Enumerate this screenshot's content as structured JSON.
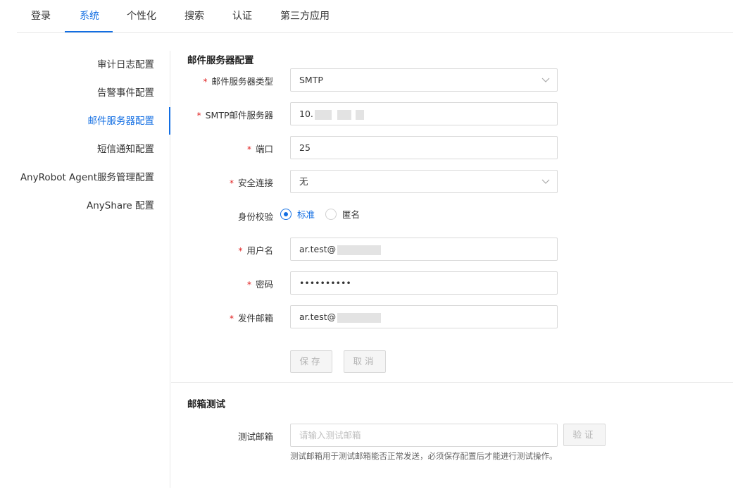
{
  "top_tabs": [
    "登录",
    "系统",
    "个性化",
    "搜索",
    "认证",
    "第三方应用"
  ],
  "side_nav": [
    "审计日志配置",
    "告警事件配置",
    "邮件服务器配置",
    "短信通知配置",
    "AnyRobot Agent服务管理配置",
    "AnyShare 配置"
  ],
  "mail_server": {
    "title": "邮件服务器配置",
    "required_mark": "*",
    "type_label": "邮件服务器类型",
    "type_value": "SMTP",
    "smtp_label": "SMTP邮件服务器",
    "smtp_value": "10.",
    "port_label": "端口",
    "port_value": "25",
    "security_label": "安全连接",
    "security_value": "无",
    "auth_label": "身份校验",
    "auth_options": [
      "标准",
      "匿名"
    ],
    "auth_selected": "标准",
    "username_label": "用户名",
    "username_value": "ar.test@",
    "password_label": "密码",
    "password_value": "••••••••••",
    "sender_label": "发件邮箱",
    "sender_value": "ar.test@",
    "save_label": "保存",
    "cancel_label": "取消"
  },
  "mail_test": {
    "title": "邮箱测试",
    "test_label": "测试邮箱",
    "test_placeholder": "请输入测试邮箱",
    "verify_label": "验证",
    "hint": "测试邮箱用于测试邮箱能否正常发送，必须保存配置后才能进行测试操作。"
  },
  "colors": {
    "accent": "#126ee3",
    "required": "#e02020",
    "border": "#d9d9d9"
  }
}
